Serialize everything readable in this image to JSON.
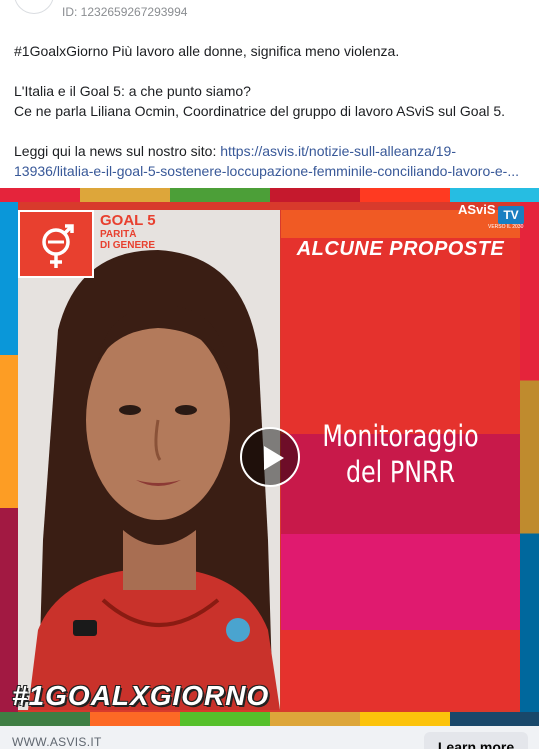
{
  "post": {
    "id_text": "ID: 1232659267293994",
    "line1": "#1GoalxGiorno Più lavoro alle donne, significa meno violenza.",
    "line2": "L'Italia e il Goal 5: a che punto siamo?",
    "line3": "Ce ne parla Liliana Ocmin, Coordinatrice del gruppo di lavoro ASviS sul Goal 5.",
    "line4_prefix": "Leggi qui la news sul nostro sito: ",
    "link_line1": "https://asvis.it/notizie-sull-alleanza/19-",
    "link_line2": "13936/litalia-e-il-goal-5-sostenere-loccupazione-femminile-conciliando-lavoro-e-..."
  },
  "video": {
    "goal_title": "GOAL 5",
    "goal_sub_line1": "PARITÀ",
    "goal_sub_line2": "DI GENERE",
    "headline": "ALCUNE PROPOSTE",
    "body_line1": "Monitoraggio",
    "body_line2": "del PNRR",
    "brand_logo": "ASviS",
    "brand_tv": "TV",
    "brand_sub": "VERSO IL 2030",
    "hashtag": "#1GOALXGIORNO"
  },
  "footer": {
    "domain": "WWW.ASVIS.IT",
    "cta_label": "Learn more"
  },
  "colors": {
    "goal5_red": "#e8402f",
    "link_blue": "#385898",
    "headline_band": "#e5322d",
    "band_magenta": "#c8194a",
    "band_pink": "#e01a6f"
  },
  "icons": {
    "play": "play-icon",
    "gender_equality": "gender-equality-icon"
  }
}
